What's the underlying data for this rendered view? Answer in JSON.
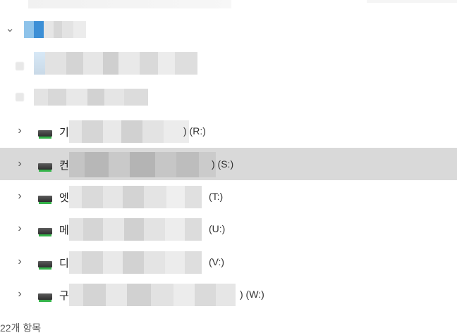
{
  "tree": {
    "root": {
      "chevron": "chevron-down-icon"
    },
    "drives": [
      {
        "prefix": "기",
        "letter": ") (R:)",
        "icon": "drive-icon"
      },
      {
        "prefix": "컨",
        "letter": ") (S:)",
        "icon": "drive-icon",
        "selected": true
      },
      {
        "prefix": "엣",
        "letter": "(T:)",
        "icon": "drive-icon"
      },
      {
        "prefix": "메",
        "letter": "(U:)",
        "icon": "drive-icon"
      },
      {
        "prefix": "디",
        "letter": "(V:)",
        "icon": "drive-icon"
      },
      {
        "prefix": "구",
        "letter": ") (W:)",
        "icon": "drive-icon"
      }
    ]
  },
  "status_bar": {
    "item_count": "22개 항목"
  },
  "colors": {
    "selected_row": "#d9d9d9",
    "drive_led": "#35b34a"
  }
}
